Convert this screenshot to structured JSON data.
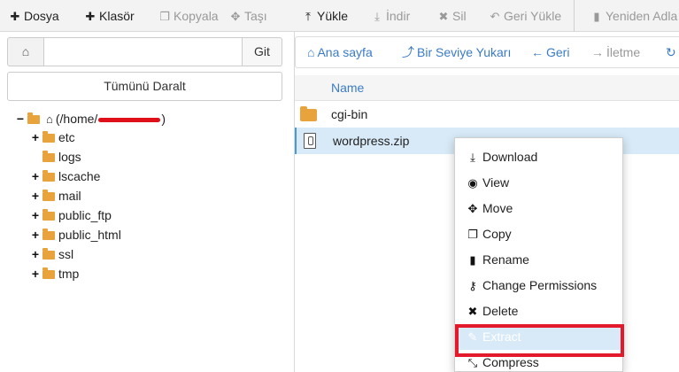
{
  "toolbar": {
    "items": [
      {
        "label": "Dosya",
        "icon": "plus-icon",
        "enabled": true
      },
      {
        "label": "Klasör",
        "icon": "plus-icon",
        "enabled": true
      },
      {
        "label": "Kopyala",
        "icon": "copy-icon",
        "enabled": false
      },
      {
        "label": "Taşı",
        "icon": "move-icon",
        "enabled": false
      },
      {
        "label": "Yükle",
        "icon": "upload-icon",
        "enabled": true
      },
      {
        "label": "İndir",
        "icon": "download-icon",
        "enabled": false
      },
      {
        "label": "Sil",
        "icon": "close-icon",
        "enabled": false
      },
      {
        "label": "Geri Yükle",
        "icon": "undo-icon",
        "enabled": false
      },
      {
        "label": "Yeniden Adla",
        "icon": "file-icon",
        "enabled": false
      }
    ]
  },
  "left_panel": {
    "path_value": "",
    "go_label": "Git",
    "collapse_label": "Tümünü Daralt",
    "tree": {
      "root_label_prefix": "(/home/",
      "root_label_suffix": ")",
      "root_toggle": "−",
      "items": [
        {
          "label": "etc",
          "toggle": "+"
        },
        {
          "label": "logs",
          "toggle": ""
        },
        {
          "label": "lscache",
          "toggle": "+"
        },
        {
          "label": "mail",
          "toggle": "+"
        },
        {
          "label": "public_ftp",
          "toggle": "+"
        },
        {
          "label": "public_html",
          "toggle": "+"
        },
        {
          "label": "ssl",
          "toggle": "+"
        },
        {
          "label": "tmp",
          "toggle": "+"
        }
      ]
    }
  },
  "navbar": {
    "items": [
      {
        "label": "Ana sayfa",
        "icon": "home-icon",
        "enabled": true
      },
      {
        "label": "Bir Seviye Yukarı",
        "icon": "level-up-icon",
        "enabled": true
      },
      {
        "label": "Geri",
        "icon": "arrow-left-icon",
        "enabled": true
      },
      {
        "label": "İletme",
        "icon": "arrow-right-icon",
        "enabled": false
      }
    ]
  },
  "file_list": {
    "column_header": "Name",
    "rows": [
      {
        "name": "cgi-bin",
        "type": "folder",
        "selected": false
      },
      {
        "name": "wordpress.zip",
        "type": "zip",
        "selected": true
      }
    ]
  },
  "context_menu": {
    "items": [
      {
        "label": "Download",
        "icon": "download-icon"
      },
      {
        "label": "View",
        "icon": "eye-icon"
      },
      {
        "label": "Move",
        "icon": "move-icon"
      },
      {
        "label": "Copy",
        "icon": "copy-icon"
      },
      {
        "label": "Rename",
        "icon": "file-icon"
      },
      {
        "label": "Change Permissions",
        "icon": "key-icon"
      },
      {
        "label": "Delete",
        "icon": "close-icon"
      },
      {
        "label": "Extract",
        "icon": "pencil-icon",
        "highlighted": true
      },
      {
        "label": "Compress",
        "icon": "compress-icon"
      }
    ]
  },
  "colors": {
    "link_blue": "#3a7bc8",
    "folder_orange": "#e8a33d",
    "selection_blue": "#d8eaf8",
    "highlight_red": "#e21a2c"
  }
}
